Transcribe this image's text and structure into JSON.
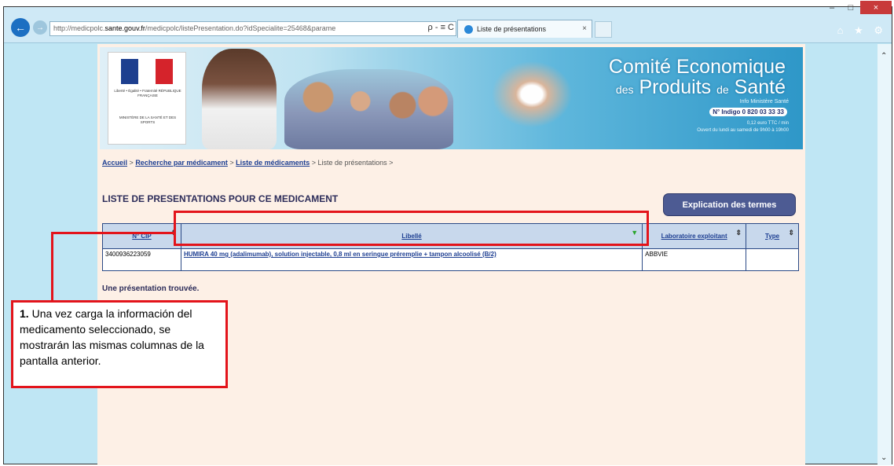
{
  "browser": {
    "address_prefix": "http://medicpolc.",
    "address_domain": "sante.gouv.fr",
    "address_rest": "/medicpolc/listePresentation.do?idSpecialite=25468&parame",
    "address_icons": "ρ - ≡ C",
    "tab_title": "Liste de présentations",
    "tab_close": "×",
    "window_buttons": [
      "–",
      "□",
      "×"
    ],
    "toolbar_icons": "⌂ ★ ⚙"
  },
  "banner": {
    "rf_text": "Liberté • Égalité • Fraternité RÉPUBLIQUE FRANÇAISE",
    "ministry_text": "MINISTÈRE DE LA SANTÉ ET DES SPORTS",
    "title_line1": "Comité Economique",
    "title_line2_small": "des",
    "title_line2": "Produits",
    "title_line2_small2": "de",
    "title_line2_end": "Santé",
    "info_ministere": "Info Ministère Santé",
    "indigo": "N° Indigo 0 820 03 33 33",
    "tarif": "0,12 euro TTC / min",
    "horaires": "Ouvert du lundi au samedi de 9h00 à 19h00"
  },
  "breadcrumb": {
    "accueil": "Accueil",
    "recherche": "Recherche par médicament",
    "liste_med": "Liste de médicaments",
    "current": "Liste de présentations",
    "sep": ">"
  },
  "main": {
    "title": "LISTE DE PRESENTATIONS POUR CE MEDICAMENT",
    "explication_button": "Explication des termes",
    "found_text": "Une présentation trouvée."
  },
  "table": {
    "headers": [
      "N° CIP",
      "Libellé",
      "Laboratoire exploitant",
      "Type"
    ],
    "rows": [
      {
        "cip": "3400936223059",
        "libelle": "HUMIRA 40 mg (adalimumab), solution injectable, 0,8 ml en seringue préremplie + tampon alcoolisé (B/2)",
        "laboratoire": "ABBVIE",
        "type": ""
      }
    ]
  },
  "annotation": {
    "text_bold_num": "1.",
    "text": "Una vez carga la información del medicamento seleccionado, se mostrarán las mismas columnas de la pantalla anterior."
  },
  "colors": {
    "annotation_red": "#e3141b",
    "button_blue": "#4d5b93",
    "page_bg": "#fdf0e6"
  }
}
